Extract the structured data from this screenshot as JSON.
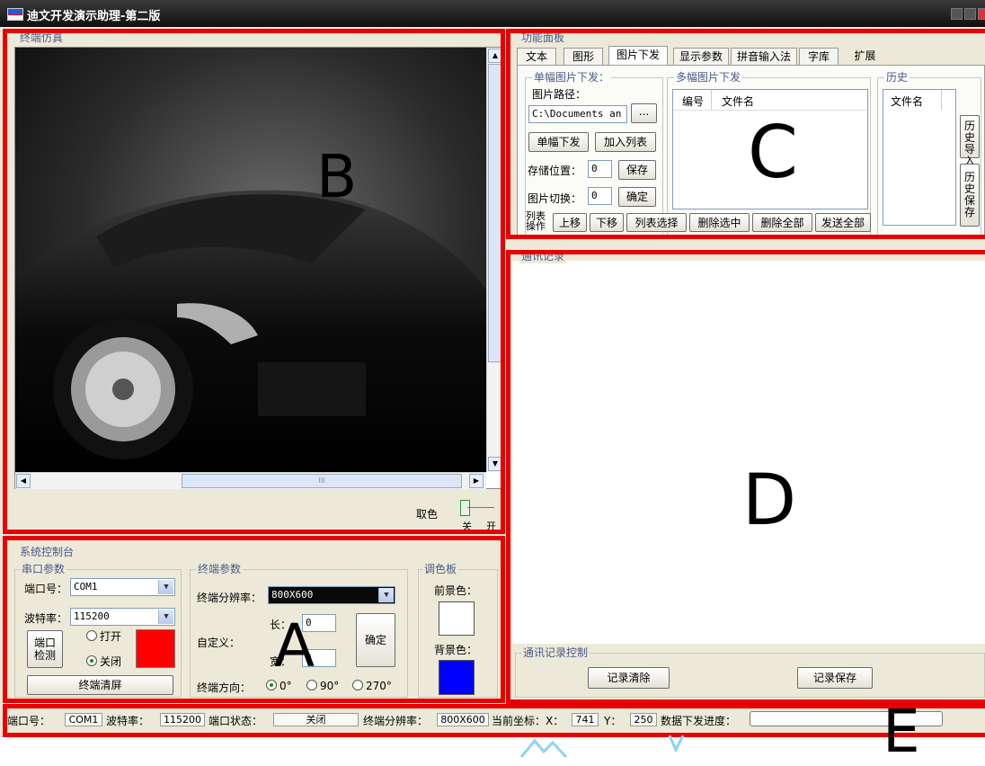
{
  "window": {
    "title": "迪文开发演示助理-第二版"
  },
  "panels": {
    "terminal_sim": "终端仿真",
    "function_panel": "功能面板",
    "comm_log": "通讯记录",
    "log_control": "通讯记录控制",
    "system_console": "系统控制台"
  },
  "annotations": {
    "a": "A",
    "b": "B",
    "c": "C",
    "d": "D",
    "e": "E"
  },
  "viewer": {
    "pick_color": "取色",
    "slider_off": "关",
    "slider_on": "开",
    "scroll_grip": "III"
  },
  "tabs": [
    "文本",
    "图形",
    "图片下发",
    "显示参数",
    "拼音输入法",
    "字库",
    "扩展"
  ],
  "single_image": {
    "group": "单幅图片下发：",
    "path_label": "图片路径：",
    "path_value": "C:\\Documents an",
    "browse": "...",
    "send_single": "单幅下发",
    "add_list": "加入列表",
    "store_label": "存储位置：",
    "store_value": "0",
    "save": "保存",
    "switch_label": "图片切换：",
    "switch_value": "0",
    "confirm": "确定"
  },
  "multi_image": {
    "group": "多幅图片下发",
    "col_no": "编号",
    "col_file": "文件名"
  },
  "history": {
    "group": "历史",
    "col_file": "文件名",
    "import": "历史导入",
    "save": "历史保存"
  },
  "list_ops": {
    "label": "列表操作",
    "up": "上移",
    "down": "下移",
    "select": "列表选择",
    "del_sel": "删除选中",
    "del_all": "删除全部",
    "send_all": "发送全部"
  },
  "log_buttons": {
    "clear": "记录清除",
    "save": "记录保存"
  },
  "serial": {
    "group": "串口参数",
    "port_label": "端口号：",
    "port_value": "COM1",
    "baud_label": "波特率：",
    "baud_value": "115200",
    "detect": "端口检测",
    "open": "打开",
    "close": "关闭",
    "clear_screen": "终端清屏",
    "state_color": "#ff0000"
  },
  "terminal": {
    "group": "终端参数",
    "res_label": "终端分辨率：",
    "res_value": "800X600",
    "custom_label": "自定义：",
    "len_label": "长：",
    "len_value": "0",
    "wid_label": "宽：",
    "wid_value": "0",
    "confirm": "确定",
    "dir_label": "终端方向：",
    "dir_options": [
      "0°",
      "90°",
      "270°"
    ]
  },
  "palette": {
    "group": "调色板",
    "fg_label": "前景色：",
    "bg_label": "背景色：",
    "fg_color": "#ffffff",
    "bg_color": "#0000ff"
  },
  "statusbar": {
    "port_label": "端口号：",
    "port": "COM1",
    "baud_label": "波特率：",
    "baud": "115200",
    "state_label": "端口状态：",
    "state": "关闭",
    "res_label": "终端分辨率：",
    "res": "800X600",
    "coord_label": "当前坐标：X：",
    "x": "741",
    "y_label": "Y：",
    "y": "250",
    "progress_label": "数据下发进度："
  }
}
